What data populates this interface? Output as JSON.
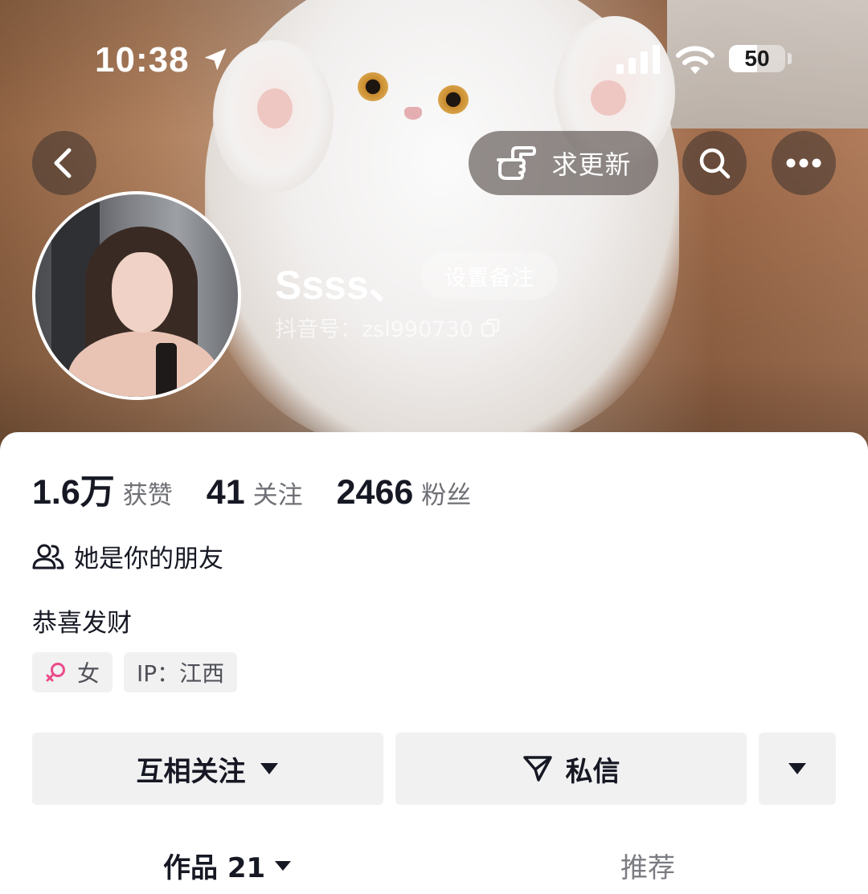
{
  "status_bar": {
    "time": "10:38",
    "battery": "50",
    "battery_level": 0.5
  },
  "header": {
    "update_request_label": "求更新"
  },
  "profile": {
    "nickname": "Ssss、",
    "set_remark_label": "设置备注",
    "douyin_id": "抖音号：zsl990730"
  },
  "stats": [
    {
      "value": "1.6万",
      "label": "获赞"
    },
    {
      "value": "41",
      "label": "关注"
    },
    {
      "value": "2466",
      "label": "粉丝"
    }
  ],
  "relation": {
    "text": "她是你的朋友",
    "icon": "friends-icon"
  },
  "bio": "恭喜发财",
  "tags": {
    "gender": "女",
    "gender_icon": "female-icon",
    "ip": "IP：江西",
    "gender_color": "#ea4c89"
  },
  "actions": {
    "follow_label": "互相关注",
    "message_label": "私信"
  },
  "tabs": {
    "works": "作品 21",
    "recommend": "推荐"
  }
}
